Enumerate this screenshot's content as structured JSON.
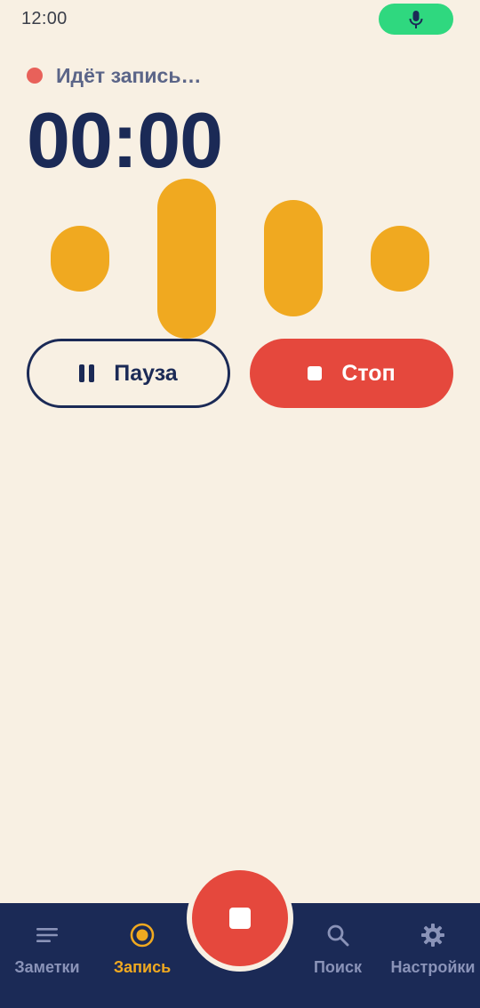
{
  "status_bar": {
    "time": "12:00",
    "mic_indicator_color": "#2FD87F",
    "mic_icon": "mic-icon"
  },
  "recording": {
    "status_label": "Идёт запись…",
    "status_dot_color": "#E8615A",
    "timer": "00:00"
  },
  "waveform": {
    "color": "#F0A920",
    "bar_count": 4
  },
  "controls": {
    "pause_label": "Пауза",
    "pause_icon": "pause-icon",
    "stop_label": "Стоп",
    "stop_icon": "stop-icon",
    "stop_color": "#E5483D"
  },
  "bottom_nav": {
    "background": "#1B2A56",
    "active_color": "#F0A920",
    "items": [
      {
        "label": "Заметки",
        "icon": "notes-icon",
        "active": false
      },
      {
        "label": "Запись",
        "icon": "record-icon",
        "active": true
      },
      {
        "label": "Поиск",
        "icon": "search-icon",
        "active": false
      },
      {
        "label": "Настройки",
        "icon": "settings-icon",
        "active": false
      }
    ],
    "fab_icon": "stop-icon"
  }
}
